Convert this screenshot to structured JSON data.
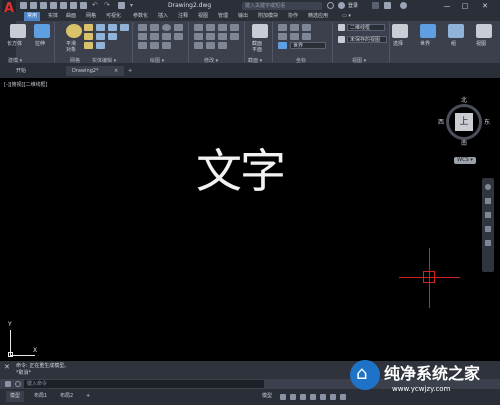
{
  "titlebar": {
    "app_letter": "A",
    "doc_title": "Drawing2.dwg",
    "search_placeholder": "键入关键字或短语",
    "login": "登录",
    "min": "—",
    "max": "□",
    "close": "✕"
  },
  "menu": [
    "常用",
    "实体",
    "曲面",
    "网格",
    "可视化",
    "参数化",
    "插入",
    "注释",
    "视图",
    "管理",
    "输出",
    "附加模块",
    "协作",
    "精选应用"
  ],
  "ribbon": {
    "tools": {
      "box": "长方体",
      "extrude": "拉伸",
      "smooth": "平滑\n对象",
      "section": "截面\n平面",
      "world": "世界",
      "select": "选择",
      "group": "组",
      "viewport": "视图"
    },
    "combos": {
      "visual_style": "二维线框",
      "unsaved": "未保存的视图",
      "ucs_world": "世界"
    },
    "panels": [
      "建模 ▾",
      "网格",
      "实体编辑 ▾",
      "绘图 ▾",
      "修改 ▾",
      "截面 ▾",
      "坐标",
      "视图 ▾"
    ]
  },
  "filetabs": {
    "start": "开始",
    "drawing": "Drawing2*",
    "close": "×",
    "add": "+"
  },
  "viewport": {
    "label": "[-][俯视][二维线框]",
    "text": "文字"
  },
  "viewcube": {
    "north": "北",
    "south": "南",
    "east": "东",
    "west": "西",
    "face": "上",
    "wcs": "WCS ▾"
  },
  "ucs": {
    "x": "X",
    "y": "Y"
  },
  "command": {
    "line1": "命令: 正在重生成模型。",
    "line2": "*取消*",
    "placeholder": "键入命令"
  },
  "statusbar": {
    "tabs": [
      "模型",
      "布局1",
      "布局2"
    ],
    "add": "+",
    "model_label": "模型"
  },
  "watermark": {
    "text": "纯净系统之家",
    "url": "www.ycwjzy.com"
  },
  "colors": {
    "accent": "#4b84c7",
    "crosshair": "#d61f1f",
    "logo": "#e03030",
    "canvas": "#000000"
  }
}
